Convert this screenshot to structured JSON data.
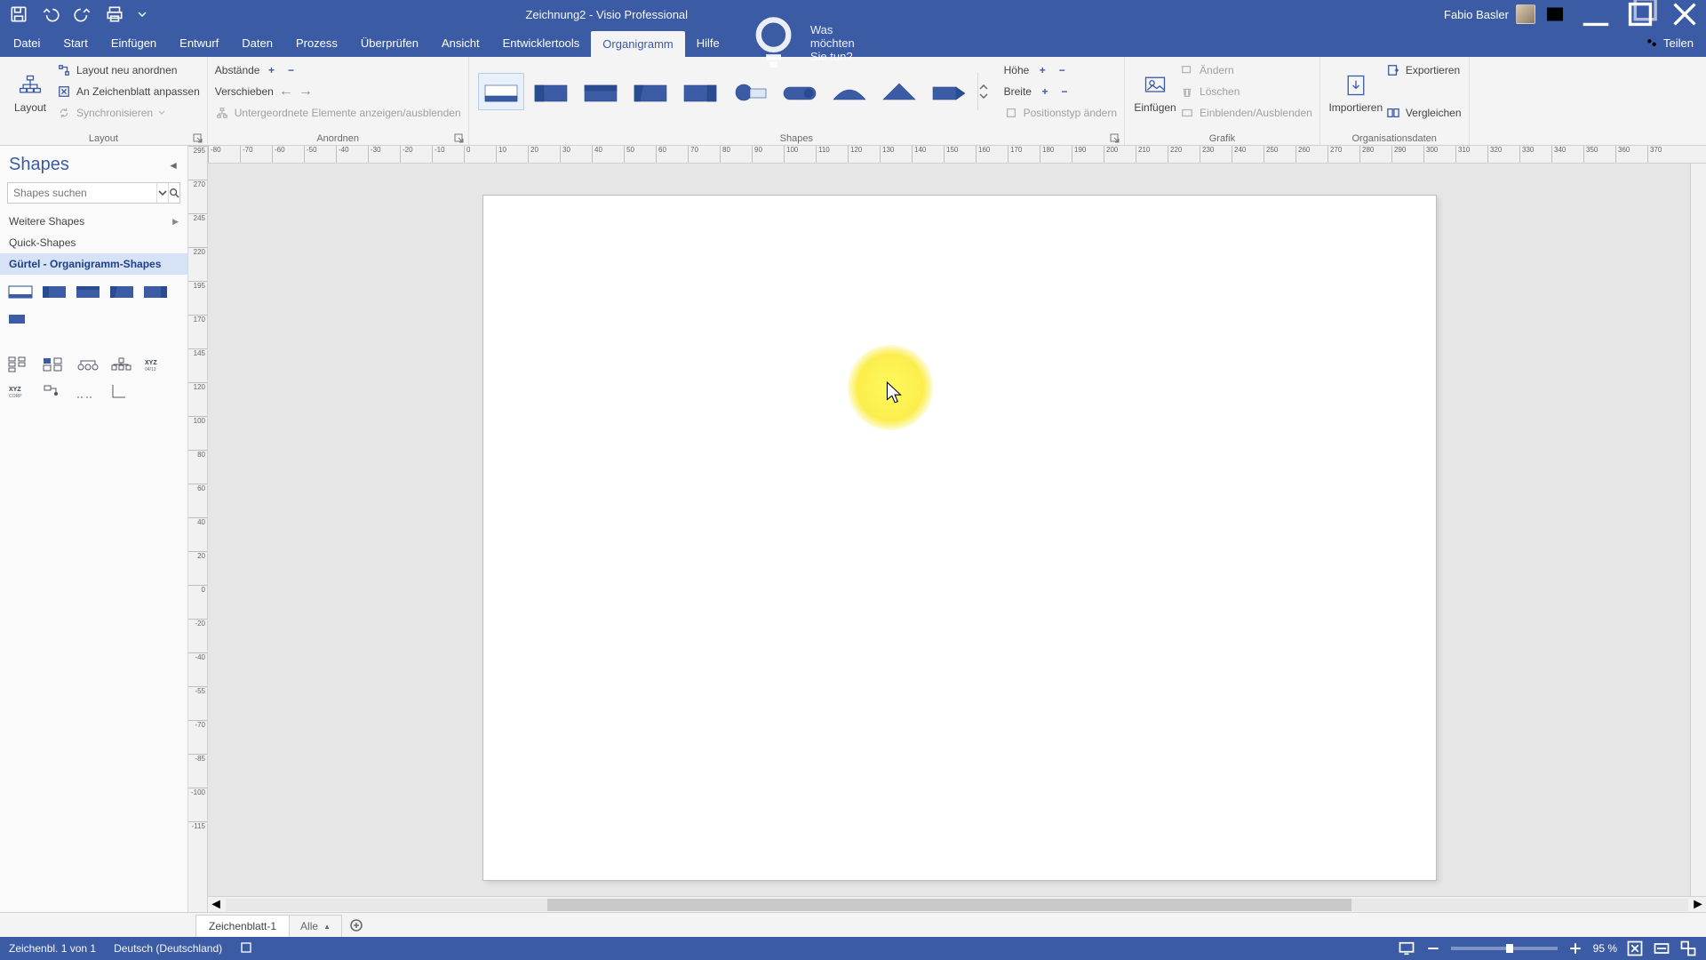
{
  "title": "Zeichnung2  -  Visio Professional",
  "user_name": "Fabio Basler",
  "share_label": "Teilen",
  "tabs": [
    "Datei",
    "Start",
    "Einfügen",
    "Entwurf",
    "Daten",
    "Prozess",
    "Überprüfen",
    "Ansicht",
    "Entwicklertools",
    "Organigramm",
    "Hilfe"
  ],
  "active_tab_index": 9,
  "tellme_placeholder": "Was möchten Sie tun?",
  "ribbon": {
    "group_layout": "Layout",
    "layout_btn": "Layout",
    "layout_neu": "Layout neu anordnen",
    "zeichenblatt": "An Zeichenblatt anpassen",
    "synchronisieren": "Synchronisieren",
    "group_anordnen": "Anordnen",
    "abstande": "Abstände",
    "verschieben": "Verschieben",
    "untergeordnete": "Untergeordnete Elemente anzeigen/ausblenden",
    "group_shapes": "Shapes",
    "hohe": "Höhe",
    "breite": "Breite",
    "positionstyp": "Positionstyp ändern",
    "group_grafik": "Grafik",
    "einfugen": "Einfügen",
    "andern": "Ändern",
    "loschen": "Löschen",
    "einblenden": "Einblenden/Ausblenden",
    "group_orgdata": "Organisationsdaten",
    "importieren": "Importieren",
    "exportieren": "Exportieren",
    "vergleichen": "Vergleichen"
  },
  "shapes_pane": {
    "title": "Shapes",
    "search_placeholder": "Shapes suchen",
    "more_shapes": "Weitere Shapes",
    "quick_shapes": "Quick-Shapes",
    "active_stencil": "Gürtel - Organigramm-Shapes"
  },
  "sheet_tab": "Zeichenblatt-1",
  "sheet_filter": "Alle",
  "status": {
    "page_of": "Zeichenbl. 1 von 1",
    "language": "Deutsch (Deutschland)",
    "zoom_pct": "95 %"
  },
  "hruler_start": -80,
  "hruler_step": 10,
  "hruler_count": 46,
  "vruler_values": [
    295,
    270,
    245,
    220,
    195,
    170,
    145,
    120,
    100,
    80,
    60,
    40,
    20,
    0,
    -20,
    -40,
    -55,
    -70,
    -85,
    -100,
    -115
  ]
}
